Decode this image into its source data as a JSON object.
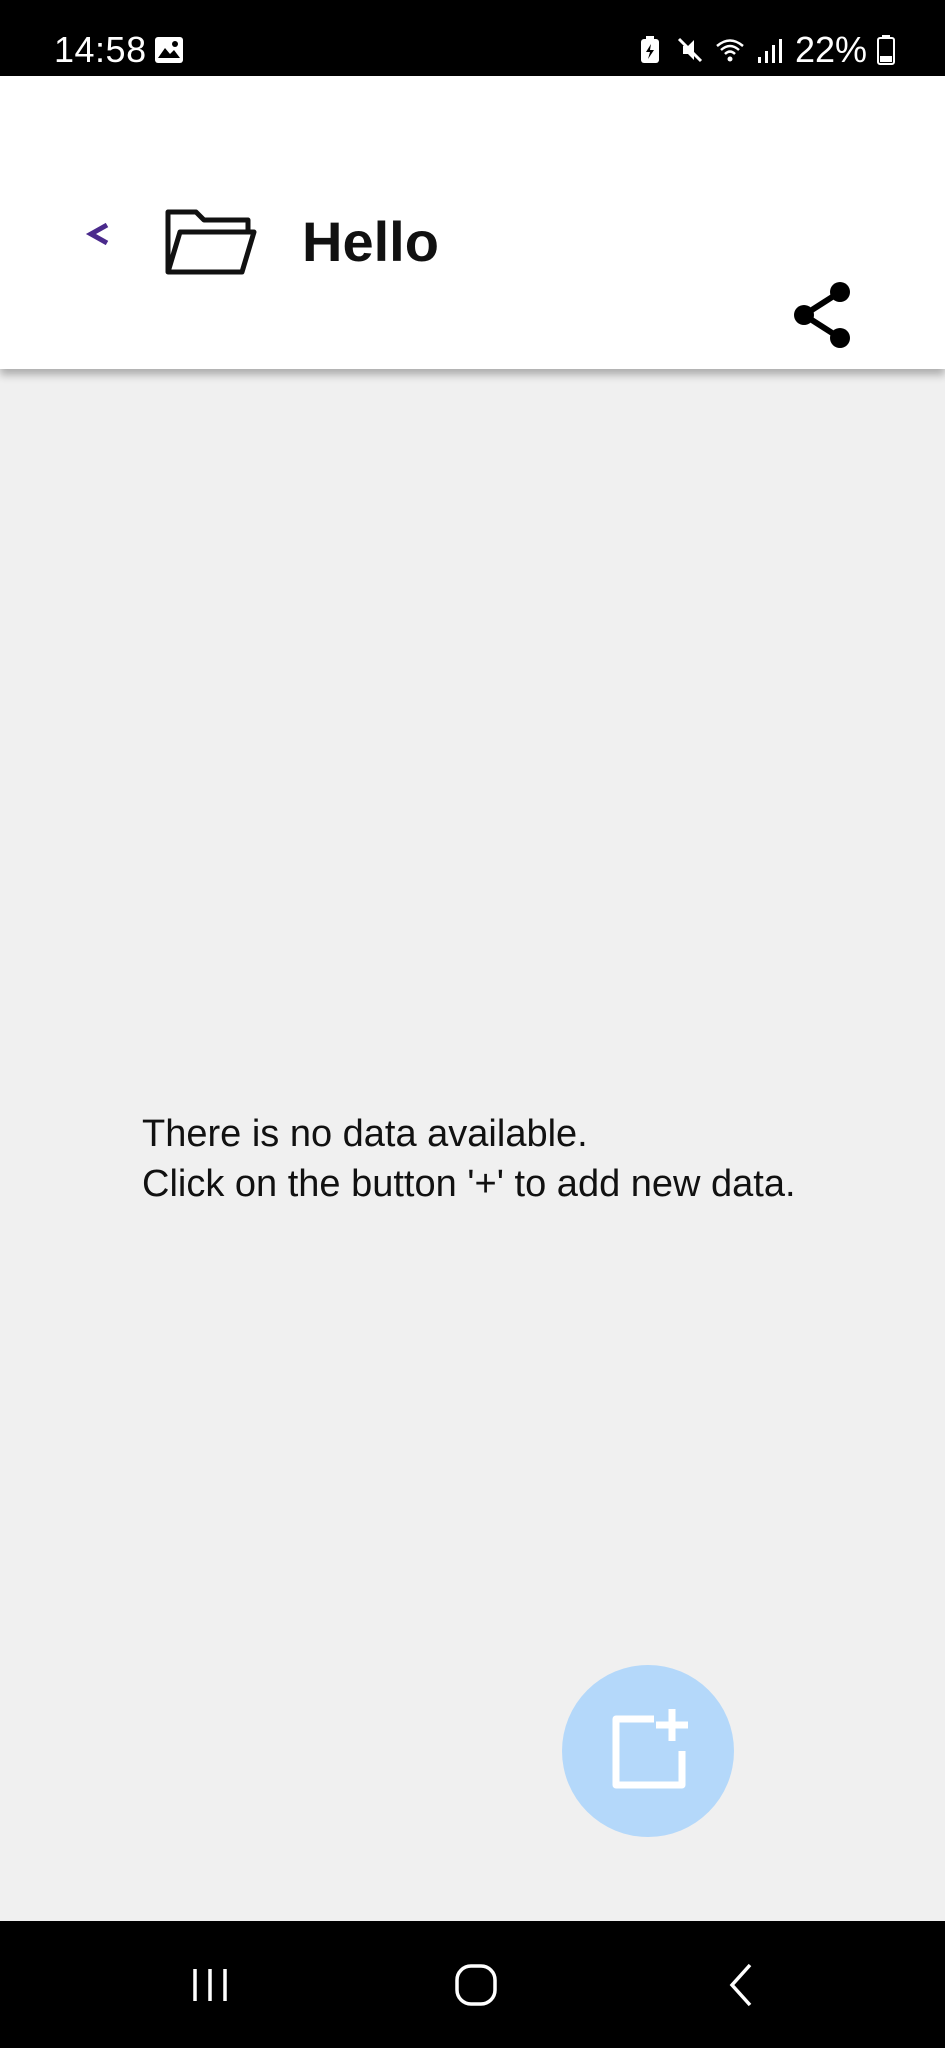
{
  "status_bar": {
    "time": "14:58",
    "battery_percent": "22%",
    "icons": [
      "gallery-icon",
      "battery-saver-icon",
      "mute-icon",
      "wifi-icon",
      "signal-icon",
      "battery-icon"
    ]
  },
  "header": {
    "back_icon": "chevron-left-icon",
    "folder_icon": "folder-open-icon",
    "title": "Hello",
    "share_icon": "share-icon",
    "accent_color": "#4a2a8c"
  },
  "main": {
    "empty_line1": "There is no data available.",
    "empty_line2": "Click on the button '+' to add new data.",
    "fab_icon": "add-note-icon",
    "fab_color": "#b4d8fa"
  },
  "nav_bar": {
    "buttons": [
      "recents-icon",
      "home-icon",
      "back-icon"
    ]
  }
}
